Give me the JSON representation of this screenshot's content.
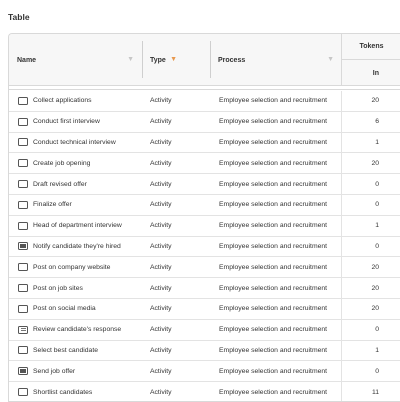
{
  "section_title": "Table",
  "columns": {
    "name": "Name",
    "type": "Type",
    "process": "Process",
    "tokens": "Tokens",
    "tokens_in": "In"
  },
  "rows": [
    {
      "icon": "task-icon",
      "name": "Collect applications",
      "type": "Activity",
      "process": "Employee selection and recruitment",
      "tokens_in": "20"
    },
    {
      "icon": "task-icon",
      "name": "Conduct first interview",
      "type": "Activity",
      "process": "Employee selection and recruitment",
      "tokens_in": "6"
    },
    {
      "icon": "task-icon",
      "name": "Conduct technical interview",
      "type": "Activity",
      "process": "Employee selection and recruitment",
      "tokens_in": "1"
    },
    {
      "icon": "task-icon",
      "name": "Create job opening",
      "type": "Activity",
      "process": "Employee selection and recruitment",
      "tokens_in": "20"
    },
    {
      "icon": "task-icon",
      "name": "Draft revised offer",
      "type": "Activity",
      "process": "Employee selection and recruitment",
      "tokens_in": "0"
    },
    {
      "icon": "task-icon",
      "name": "Finalize offer",
      "type": "Activity",
      "process": "Employee selection and recruitment",
      "tokens_in": "0"
    },
    {
      "icon": "task-icon",
      "name": "Head of department interview",
      "type": "Activity",
      "process": "Employee selection and recruitment",
      "tokens_in": "1"
    },
    {
      "icon": "send-task-icon",
      "name": "Notify candidate they're hired",
      "type": "Activity",
      "process": "Employee selection and recruitment",
      "tokens_in": "0"
    },
    {
      "icon": "task-icon",
      "name": "Post on company website",
      "type": "Activity",
      "process": "Employee selection and recruitment",
      "tokens_in": "20"
    },
    {
      "icon": "task-icon",
      "name": "Post on job sites",
      "type": "Activity",
      "process": "Employee selection and recruitment",
      "tokens_in": "20"
    },
    {
      "icon": "task-icon",
      "name": "Post on social media",
      "type": "Activity",
      "process": "Employee selection and recruitment",
      "tokens_in": "20"
    },
    {
      "icon": "user-task-icon",
      "name": "Review candidate's response",
      "type": "Activity",
      "process": "Employee selection and recruitment",
      "tokens_in": "0"
    },
    {
      "icon": "task-icon",
      "name": "Select best candidate",
      "type": "Activity",
      "process": "Employee selection and recruitment",
      "tokens_in": "1"
    },
    {
      "icon": "send-task-icon",
      "name": "Send job offer",
      "type": "Activity",
      "process": "Employee selection and recruitment",
      "tokens_in": "0"
    },
    {
      "icon": "task-icon",
      "name": "Shortlist candidates",
      "type": "Activity",
      "process": "Employee selection and recruitment",
      "tokens_in": "11"
    }
  ],
  "colors": {
    "sort_active": "#e8994f",
    "header_bg": "#f7f7f7",
    "border": "#d9d9d9"
  }
}
